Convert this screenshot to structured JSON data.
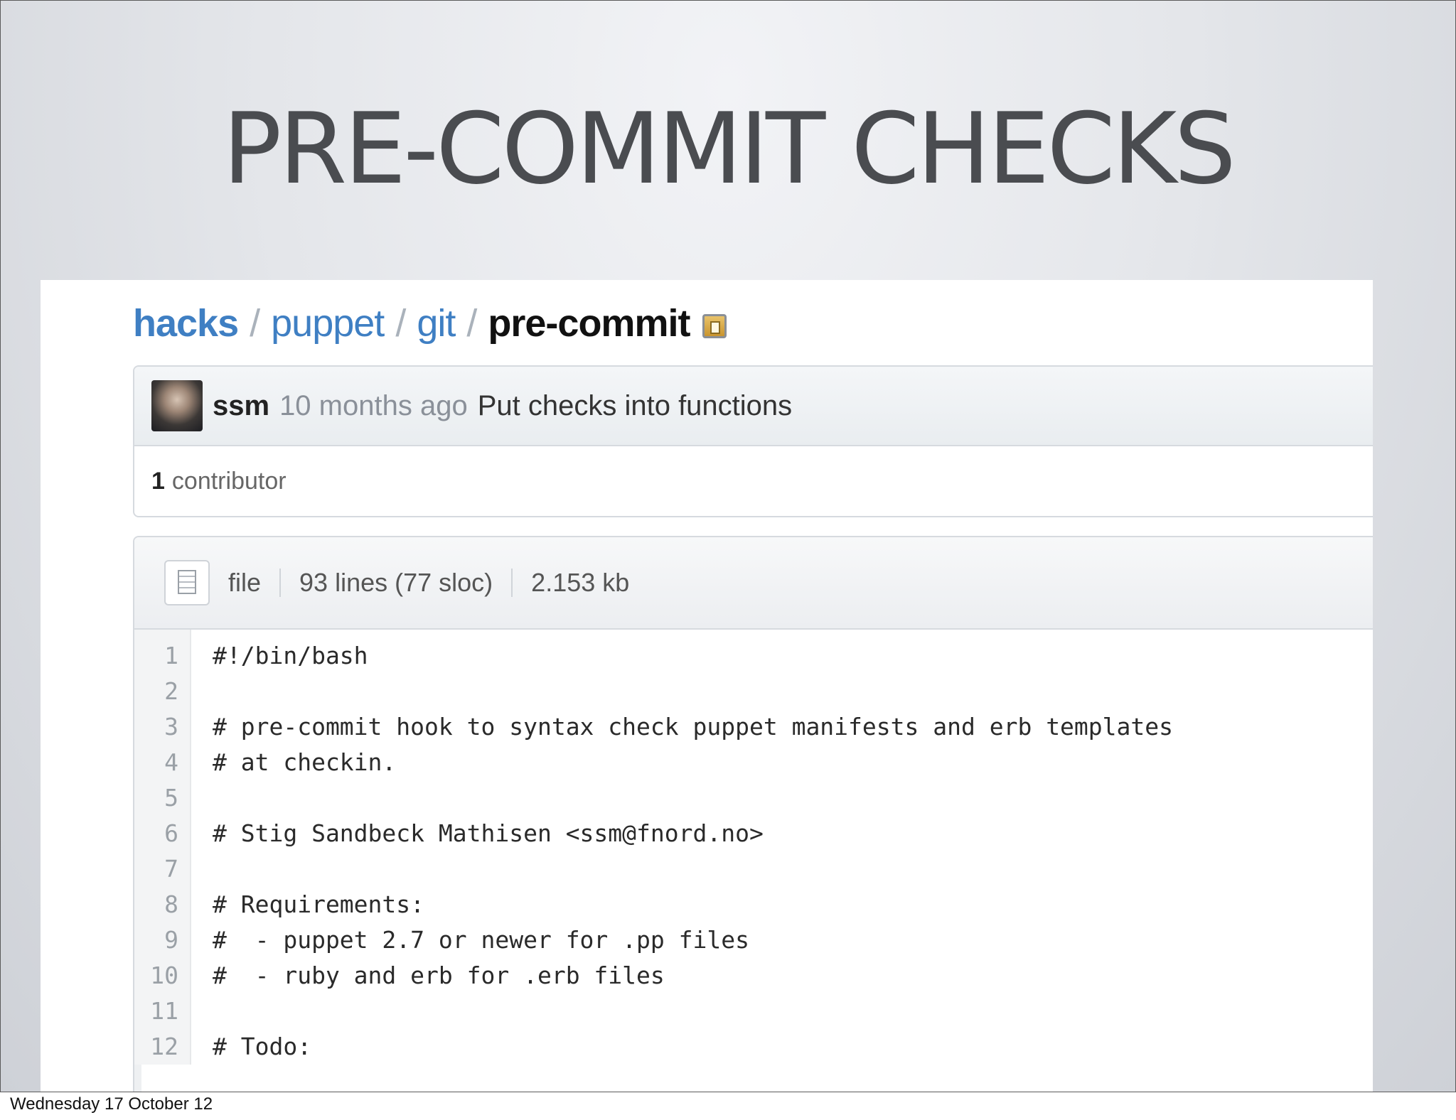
{
  "slide": {
    "title": "PRE-COMMIT CHECKS"
  },
  "breadcrumb": {
    "items": [
      "hacks",
      "puppet",
      "git"
    ],
    "separator": "/",
    "current": "pre-commit"
  },
  "commit": {
    "author": "ssm",
    "time": "10 months ago",
    "message": "Put checks into functions",
    "contributors_count": "1",
    "contributors_label": "contributor"
  },
  "file": {
    "mode": "file",
    "lines": "93 lines (77 sloc)",
    "size": "2.153 kb"
  },
  "code_lines": [
    {
      "num": "1",
      "text": "#!/bin/bash"
    },
    {
      "num": "2",
      "text": ""
    },
    {
      "num": "3",
      "text": "# pre-commit hook to syntax check puppet manifests and erb templates"
    },
    {
      "num": "4",
      "text": "# at checkin."
    },
    {
      "num": "5",
      "text": ""
    },
    {
      "num": "6",
      "text": "# Stig Sandbeck Mathisen <ssm@fnord.no>"
    },
    {
      "num": "7",
      "text": ""
    },
    {
      "num": "8",
      "text": "# Requirements:"
    },
    {
      "num": "9",
      "text": "#  - puppet 2.7 or newer for .pp files"
    },
    {
      "num": "10",
      "text": "#  - ruby and erb for .erb files"
    },
    {
      "num": "11",
      "text": ""
    },
    {
      "num": "12",
      "text": "# Todo:"
    }
  ],
  "footer": {
    "date": "Wednesday 17 October 12"
  },
  "colors": {
    "link": "#3f7fc3",
    "title": "#4a4c50",
    "muted": "#8a9099"
  },
  "icons": {
    "clipboard": "clipboard-icon",
    "avatar": "avatar",
    "file": "file-icon"
  }
}
